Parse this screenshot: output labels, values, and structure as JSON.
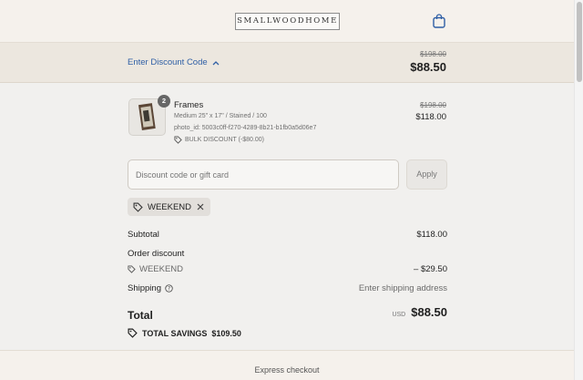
{
  "header": {
    "logo_text": "SMALLWOODHOME",
    "cart_icon": "shopping-bag-icon"
  },
  "summary": {
    "toggle_label": "Enter Discount Code",
    "original_total": "$198.00",
    "total": "$88.50"
  },
  "item": {
    "quantity": "2",
    "name": "Frames",
    "variant": "Medium 25\" x 17\" / Stained / 100",
    "photo_id": "photo_id: 5003c0ff-f270-4289-8b21-b1fb0a5d06e7",
    "discount": "BULK DISCOUNT (-$80.00)",
    "original_price": "$198.00",
    "price": "$118.00"
  },
  "discount_field": {
    "placeholder": "Discount code or gift card",
    "apply_label": "Apply"
  },
  "applied_code": {
    "code": "WEEKEND"
  },
  "totals": {
    "subtotal_label": "Subtotal",
    "subtotal_value": "$118.00",
    "order_discount_label": "Order discount",
    "discount_code": "WEEKEND",
    "discount_value": "– $29.50",
    "shipping_label": "Shipping",
    "shipping_value": "Enter shipping address",
    "total_label": "Total",
    "currency": "USD",
    "total_value": "$88.50",
    "savings_label": "TOTAL SAVINGS",
    "savings_value": "$109.50"
  },
  "footer": {
    "express_label": "Express checkout"
  },
  "colors": {
    "link": "#2f5fa5",
    "header_bg": "#f5f1ec",
    "summary_bg": "#ece7df",
    "page_bg": "#f1f0ee"
  }
}
